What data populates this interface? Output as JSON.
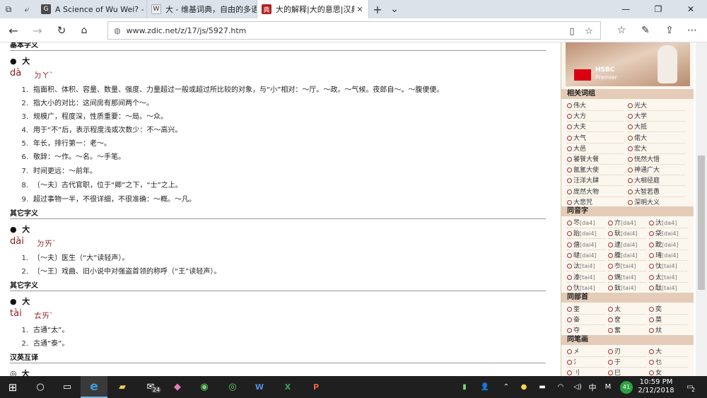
{
  "browser": {
    "tabs": [
      {
        "title": "A Science of Wu Wei? - Pag",
        "icon": "G",
        "icon_bg": "#4a4a4a"
      },
      {
        "title": "大 - 维基词典，自由的多语",
        "icon": "W",
        "icon_bg": "#eeeeee"
      },
      {
        "title": "大的解释|大的意思|汉典",
        "icon": "典",
        "icon_bg": "#b22222"
      }
    ],
    "new_tab_symbol": "+",
    "tab_list_symbol": "⌄",
    "url": "www.zdic.net/z/17/js/5927.htm"
  },
  "main": {
    "top_cut_heading": "基本字义",
    "sections": [
      {
        "bullet": "●",
        "char": "大",
        "pinyin": "dà",
        "zhuyin": "ㄉㄚˋ",
        "defs": [
          "指面积、体积、容量、数量、强度、力量超过一般或超过所比较的对象，与“小”相对：～厅。～政。～气候。夜郎自～。～腹便便。",
          "指大小的对比：这间房有那间两个～。",
          "规模广，程度深，性质重要：～局。～众。",
          "用于“不”后，表示程度浅或次数少：不～高兴。",
          "年长，排行第一：老～。",
          "敬辞：～作。～名。～手笔。",
          "时间更远：～前年。",
          "〔～夫〕古代官职，位于“卿”之下，“士”之上。",
          "超过事物一半，不很详细，不很准确：～概。～凡。"
        ]
      },
      {
        "heading": "其它字义",
        "bullet": "●",
        "char": "大",
        "pinyin": "dài",
        "zhuyin": "ㄉㄞˋ",
        "defs": [
          "〔～夫〕医生（“大”读轻声）。",
          "〔～王〕戏曲、旧小说中对强盗首领的称呼（“王”读轻声）。"
        ]
      },
      {
        "heading": "其它字义",
        "bullet": "●",
        "char": "大",
        "pinyin": "tài",
        "zhuyin": "ㄊㄞˋ",
        "defs": [
          "古通“太”。",
          "古通“泰”。"
        ]
      }
    ],
    "bottom_heading": "汉英互译",
    "bottom_char_bullet": "◎",
    "bottom_char": "大"
  },
  "sidebar": {
    "ad_brand": "HSBC",
    "ad_brand_sub": "Premier",
    "related_words_title": "相关词组",
    "related_words": [
      "伟大",
      "光大",
      "大方",
      "大学",
      "大夫",
      "大抵",
      "大气",
      "偌大",
      "大邑",
      "宏大",
      "饕餮大餐",
      "恍然大悟",
      "氤氲大使",
      "神通广大",
      "汪洋大肆",
      "大相径庭",
      "庞然大物",
      "大智若愚",
      "大悲咒",
      "深明大义"
    ],
    "same_sound_title": "同音字",
    "same_sound": [
      {
        "ch": "罖",
        "py": "[da4]"
      },
      {
        "ch": "亣",
        "py": "[da4]"
      },
      {
        "ch": "汏",
        "py": "[da4]"
      },
      {
        "ch": "跆",
        "py": "[dai4]"
      },
      {
        "ch": "轪",
        "py": "[dai4]"
      },
      {
        "ch": "柋",
        "py": "[dai4]"
      },
      {
        "ch": "傏",
        "py": "[dai4]"
      },
      {
        "ch": "逮",
        "py": "[dai4]"
      },
      {
        "ch": "黕",
        "py": "[dai4]"
      },
      {
        "ch": "曃",
        "py": "[dai4]"
      },
      {
        "ch": "黱",
        "py": "[dai4]"
      },
      {
        "ch": "瑇",
        "py": "[dai4]"
      },
      {
        "ch": "汰",
        "py": "[tai4]"
      },
      {
        "ch": "冭",
        "py": "[tai4]"
      },
      {
        "ch": "忲",
        "py": "[tai4]"
      },
      {
        "ch": "溙",
        "py": "[tai4]"
      },
      {
        "ch": "燤",
        "py": "[tai4]"
      },
      {
        "ch": "太",
        "py": "[tai4]"
      },
      {
        "ch": "忕",
        "py": "[tai4]"
      },
      {
        "ch": "鈦",
        "py": "[tai4]"
      },
      {
        "ch": "酞",
        "py": "[tai4]"
      }
    ],
    "same_radical_title": "同部首",
    "same_radical": [
      "奎",
      "太",
      "奕",
      "奋",
      "奁",
      "莫",
      "夺",
      "奮",
      "夶"
    ],
    "same_strokes_title": "同笔画",
    "same_strokes": [
      "㐅",
      "刃",
      "大",
      "氵",
      "于",
      "乜",
      "刂",
      "巳",
      "女"
    ]
  },
  "taskbar": {
    "time": "10:59 PM",
    "date": "2/12/2018",
    "mail_badge": "24",
    "ime_label": "中",
    "ime_mode": "M",
    "tray_badge": "41",
    "notif_count": "2"
  }
}
